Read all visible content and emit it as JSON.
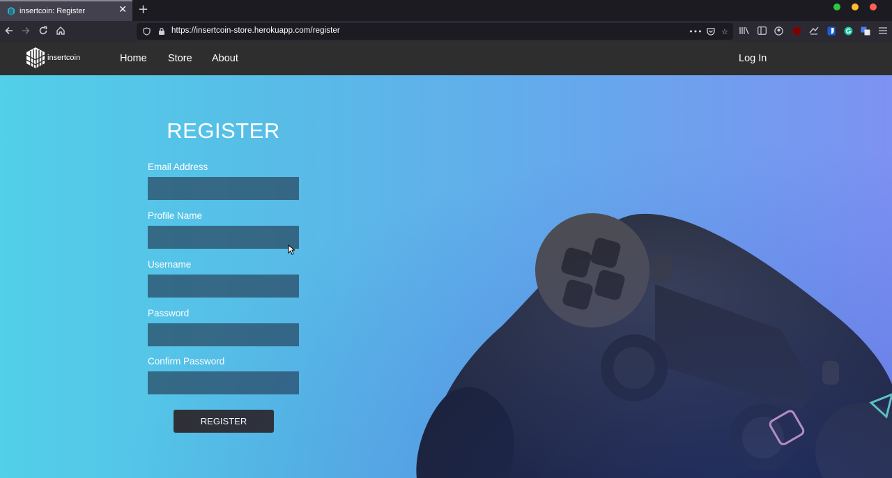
{
  "browser": {
    "tab_title": "insertcoin: Register",
    "tab_close_icon": "close-icon",
    "new_tab_icon": "plus-icon",
    "url": "https://insertcoin-store.herokuapp.com/register",
    "window_controls": {
      "green": "#2ac940",
      "yellow": "#febc2e",
      "red": "#ff5f57"
    },
    "nav_icons": [
      "back-arrow-icon",
      "forward-arrow-icon",
      "reload-icon",
      "home-icon"
    ],
    "toolbar_icons": [
      "library-icon",
      "sidebar-icon",
      "account-icon",
      "ublock-icon",
      "extension-icon",
      "bitwarden-icon",
      "grammarly-icon",
      "translate-icon",
      "menu-icon"
    ]
  },
  "site": {
    "brand": "insertcoin",
    "nav": {
      "home": "Home",
      "store": "Store",
      "about": "About",
      "login": "Log In"
    },
    "header_bg": "#2e2e2e"
  },
  "form": {
    "title": "REGISTER",
    "email_label": "Email Address",
    "profile_label": "Profile Name",
    "username_label": "Username",
    "password_label": "Password",
    "confirm_label": "Confirm Password",
    "email_value": "",
    "profile_value": "",
    "username_value": "",
    "password_value": "",
    "confirm_value": "",
    "submit_label": "REGISTER"
  },
  "hero": {
    "gradient_start": "#52cfe9",
    "gradient_end": "#7d92f2",
    "image": "game-controller-photo"
  }
}
